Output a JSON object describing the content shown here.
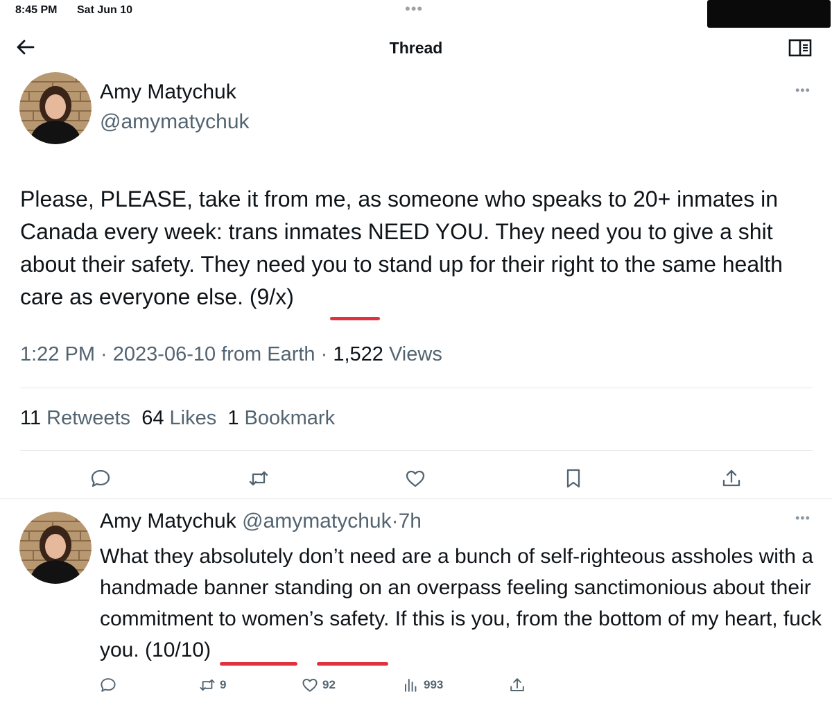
{
  "status_bar": {
    "time": "8:45 PM",
    "date": "Sat Jun 10"
  },
  "header": {
    "title": "Thread"
  },
  "main_tweet": {
    "name": "Amy Matychuk",
    "handle": "@amymatychuk",
    "text_body": "Please, PLEASE, take it from me, as someone who speaks to 20+ inmates in Canada every week: trans inmates NEED YOU. They need you to give a shit about their safety. They need you to stand up for their right to the same health care as everyone else. ",
    "text_marker": "(9/x)",
    "time": "1:22 PM",
    "date": "2023-06-10",
    "source": "from Earth",
    "views_count": "1,522",
    "views_label": "Views",
    "retweets_count": "11",
    "retweets_label": "Retweets",
    "likes_count": "64",
    "likes_label": "Likes",
    "bookmarks_count": "1",
    "bookmarks_label": "Bookmark"
  },
  "reply_tweet": {
    "name": "Amy Matychuk",
    "handle": "@amymatychuk",
    "age": "7h",
    "text_body": "What they absolutely don’t need are a bunch of self-righteous assholes with a handmade banner standing on an overpass feeling sanctimonious about their commitment to women’s safety. If this is you, from the bottom of my heart, ",
    "text_emph": "fuck you",
    "text_marker": "(10/10)",
    "retweets": "9",
    "likes": "92",
    "views": "993"
  },
  "colors": {
    "underline": "#e0323e",
    "secondary_text": "#536471",
    "divider": "#e3e6e8"
  },
  "icons": [
    "back-arrow-icon",
    "reader-mode-icon",
    "more-icon",
    "reply-icon",
    "retweet-icon",
    "like-icon",
    "bookmark-icon",
    "share-icon",
    "views-icon"
  ]
}
